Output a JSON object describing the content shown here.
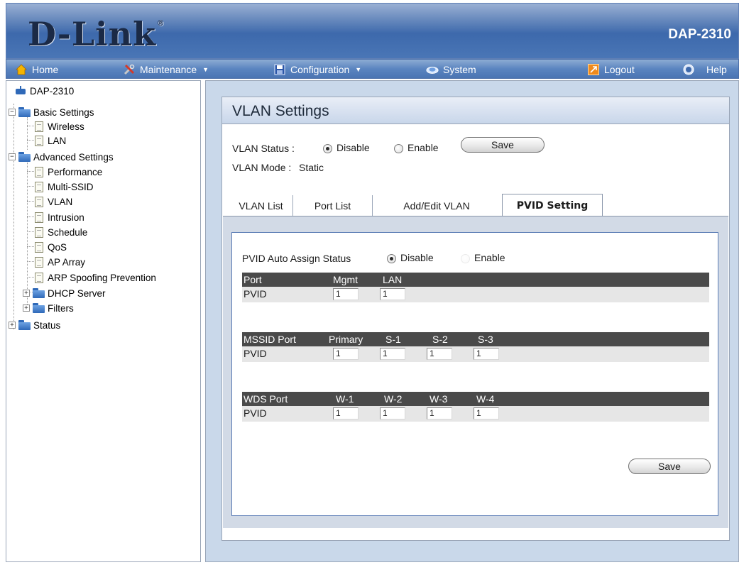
{
  "header": {
    "brand": "D-Link",
    "model": "DAP-2310"
  },
  "menu": {
    "home": "Home",
    "maintenance": "Maintenance",
    "configuration": "Configuration",
    "system": "System",
    "logout": "Logout",
    "help": "Help"
  },
  "tree": {
    "root": "DAP-2310",
    "basic": "Basic Settings",
    "wireless": "Wireless",
    "lan": "LAN",
    "advanced": "Advanced Settings",
    "performance": "Performance",
    "multi_ssid": "Multi-SSID",
    "vlan": "VLAN",
    "intrusion": "Intrusion",
    "schedule": "Schedule",
    "qos": "QoS",
    "ap_array": "AP Array",
    "arp": "ARP Spoofing Prevention",
    "dhcp": "DHCP Server",
    "filters": "Filters",
    "status": "Status"
  },
  "panel": {
    "title": "VLAN Settings",
    "vlan_status_label": "VLAN Status :",
    "disable": "Disable",
    "enable": "Enable",
    "save": "Save",
    "vlan_mode_label": "VLAN Mode :",
    "vlan_mode_value": "Static",
    "vlan_status_selected": "Disable"
  },
  "tabs": {
    "vlan_list": "VLAN List",
    "port_list": "Port List",
    "add_edit": "Add/Edit VLAN",
    "pvid": "PVID Setting",
    "active": "PVID Setting"
  },
  "pvid": {
    "auto_label": "PVID Auto Assign Status",
    "disable": "Disable",
    "enable": "Enable",
    "auto_selected": "Disable",
    "port_table": {
      "head": [
        "Port",
        "Mgmt",
        "LAN"
      ],
      "row_label": "PVID",
      "values": [
        "1",
        "1"
      ]
    },
    "mssid_table": {
      "head": [
        "MSSID Port",
        "Primary",
        "S-1",
        "S-2",
        "S-3"
      ],
      "row_label": "PVID",
      "values": [
        "1",
        "1",
        "1",
        "1"
      ]
    },
    "wds_table": {
      "head": [
        "WDS Port",
        "W-1",
        "W-2",
        "W-3",
        "W-4"
      ],
      "row_label": "PVID",
      "values": [
        "1",
        "1",
        "1",
        "1"
      ]
    },
    "save": "Save"
  },
  "colors": {
    "header_blue": "#3d69ac",
    "menu_blue": "#5a84c0",
    "grid_header": "#4a4a4a",
    "page_bg": "#c9d8ea"
  }
}
